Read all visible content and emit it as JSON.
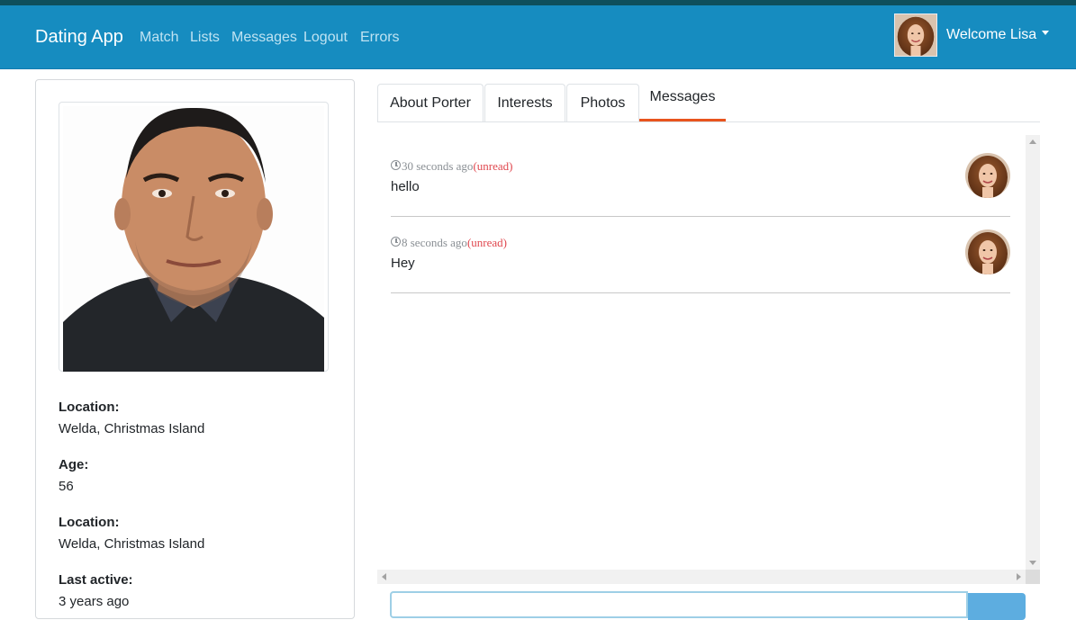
{
  "navbar": {
    "brand": "Dating App",
    "links": [
      "Match",
      "Lists",
      "Messages",
      "Logout",
      "Errors"
    ],
    "welcome": "Welcome Lisa"
  },
  "profile": {
    "fields": [
      {
        "label": "Location:",
        "value": "Welda, Christmas Island"
      },
      {
        "label": "Age:",
        "value": "56"
      },
      {
        "label": "Location:",
        "value": "Welda, Christmas Island"
      },
      {
        "label": "Last active:",
        "value": "3 years ago"
      }
    ]
  },
  "tabs": [
    "About Porter",
    "Interests",
    "Photos",
    "Messages"
  ],
  "messages": [
    {
      "time": "30 seconds ago",
      "status": "(unread)",
      "text": "hello"
    },
    {
      "time": "8 seconds ago",
      "status": "(unread)",
      "text": "Hey"
    }
  ],
  "icons": {
    "clock": "clock-icon",
    "caret": "caret-down-icon"
  },
  "colors": {
    "navbar": "#168cc0",
    "active_tab_underline": "#e8541e",
    "unread": "#e0484f"
  }
}
